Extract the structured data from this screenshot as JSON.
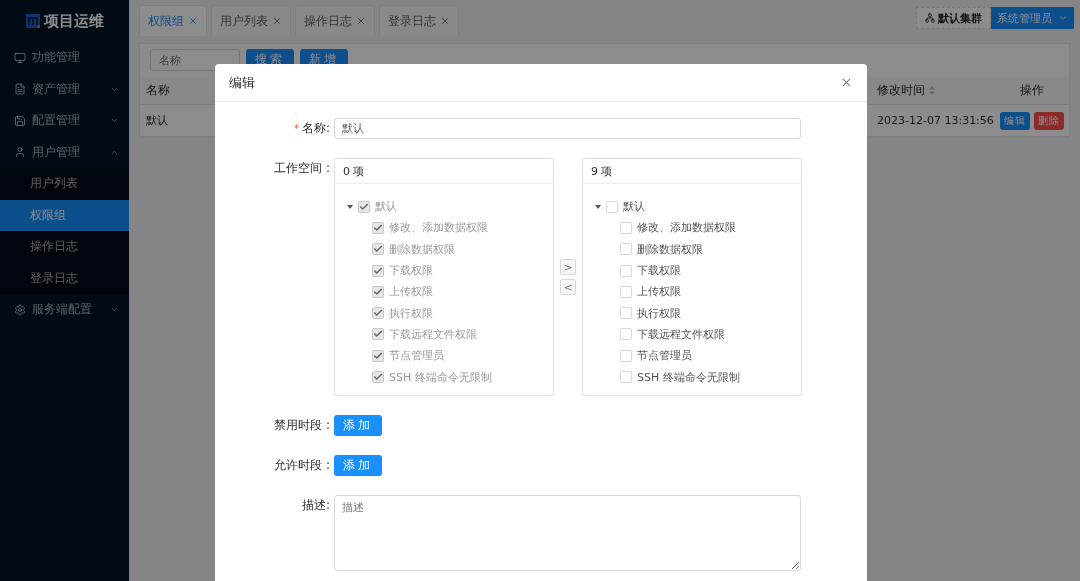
{
  "sidebar": {
    "logo": "项目运维",
    "items": [
      {
        "label": "功能管理",
        "kind": "link"
      },
      {
        "label": "资产管理",
        "kind": "submenu",
        "expanded": false
      },
      {
        "label": "配置管理",
        "kind": "submenu",
        "expanded": false
      },
      {
        "label": "用户管理",
        "kind": "submenu",
        "expanded": true,
        "children": [
          {
            "label": "用户列表",
            "selected": false
          },
          {
            "label": "权限组",
            "selected": true
          },
          {
            "label": "操作日志",
            "selected": false
          },
          {
            "label": "登录日志",
            "selected": false
          }
        ]
      },
      {
        "label": "服务端配置",
        "kind": "submenu",
        "expanded": false
      }
    ]
  },
  "tabs": [
    {
      "label": "权限组",
      "selected": true
    },
    {
      "label": "用户列表",
      "selected": false
    },
    {
      "label": "操作日志",
      "selected": false
    },
    {
      "label": "登录日志",
      "selected": false
    }
  ],
  "header": {
    "cluster": "默认集群",
    "user": "系统管理员"
  },
  "toolbar": {
    "search": {
      "placeholder": "名称"
    },
    "buttons": [
      "搜索",
      "新增"
    ]
  },
  "table": {
    "columns": [
      {
        "label": "名称",
        "sortable": false
      },
      {
        "label": "修改时间",
        "sortable": true
      },
      {
        "label": "操作",
        "sortable": false
      }
    ],
    "rows": [
      {
        "cells": [
          "默认",
          "2023-12-07 13:31:56"
        ],
        "actions": [
          {
            "label": "编辑",
            "kind": "primary"
          },
          {
            "label": "删除",
            "kind": "danger"
          }
        ]
      }
    ]
  },
  "modal": {
    "title": "编辑",
    "fields": [
      {
        "kind": "text",
        "label": "名称:",
        "marker": "*",
        "value": "默认"
      },
      {
        "kind": "transfer",
        "label": "工作空间 :",
        "lists": [
          {
            "count": "0 项",
            "tree": {
              "label": "默认",
              "checked": true,
              "disabled": true,
              "expanded": true,
              "children": [
                {
                  "label": "修改、添加数据权限",
                  "checked": true,
                  "disabled": true
                },
                {
                  "label": "删除数据权限",
                  "checked": true,
                  "disabled": true
                },
                {
                  "label": "下载权限",
                  "checked": true,
                  "disabled": true
                },
                {
                  "label": "上传权限",
                  "checked": true,
                  "disabled": true
                },
                {
                  "label": "执行权限",
                  "checked": true,
                  "disabled": true
                },
                {
                  "label": "下载远程文件权限",
                  "checked": true,
                  "disabled": true
                },
                {
                  "label": "节点管理员",
                  "checked": true,
                  "disabled": true
                },
                {
                  "label": "SSH 终端命令无限制",
                  "checked": true,
                  "disabled": true
                }
              ]
            }
          },
          {
            "count": "9 项",
            "tree": {
              "label": "默认",
              "checked": false,
              "disabled": false,
              "expanded": true,
              "children": [
                {
                  "label": "修改、添加数据权限",
                  "checked": false,
                  "disabled": false
                },
                {
                  "label": "删除数据权限",
                  "checked": false,
                  "disabled": false
                },
                {
                  "label": "下载权限",
                  "checked": false,
                  "disabled": false
                },
                {
                  "label": "上传权限",
                  "checked": false,
                  "disabled": false
                },
                {
                  "label": "执行权限",
                  "checked": false,
                  "disabled": false
                },
                {
                  "label": "下载远程文件权限",
                  "checked": false,
                  "disabled": false
                },
                {
                  "label": "节点管理员",
                  "checked": false,
                  "disabled": false
                },
                {
                  "label": "SSH 终端命令无限制",
                  "checked": false,
                  "disabled": false
                }
              ]
            }
          }
        ],
        "moves": [
          {
            "symbol": ">",
            "disabled": true
          },
          {
            "symbol": "<",
            "disabled": true
          }
        ]
      },
      {
        "kind": "button",
        "label": "禁用时段 :",
        "button": "添加"
      },
      {
        "kind": "button",
        "label": "允许时段 :",
        "button": "添加"
      },
      {
        "kind": "textarea",
        "label": "描述:",
        "placeholder": "描述"
      }
    ]
  }
}
